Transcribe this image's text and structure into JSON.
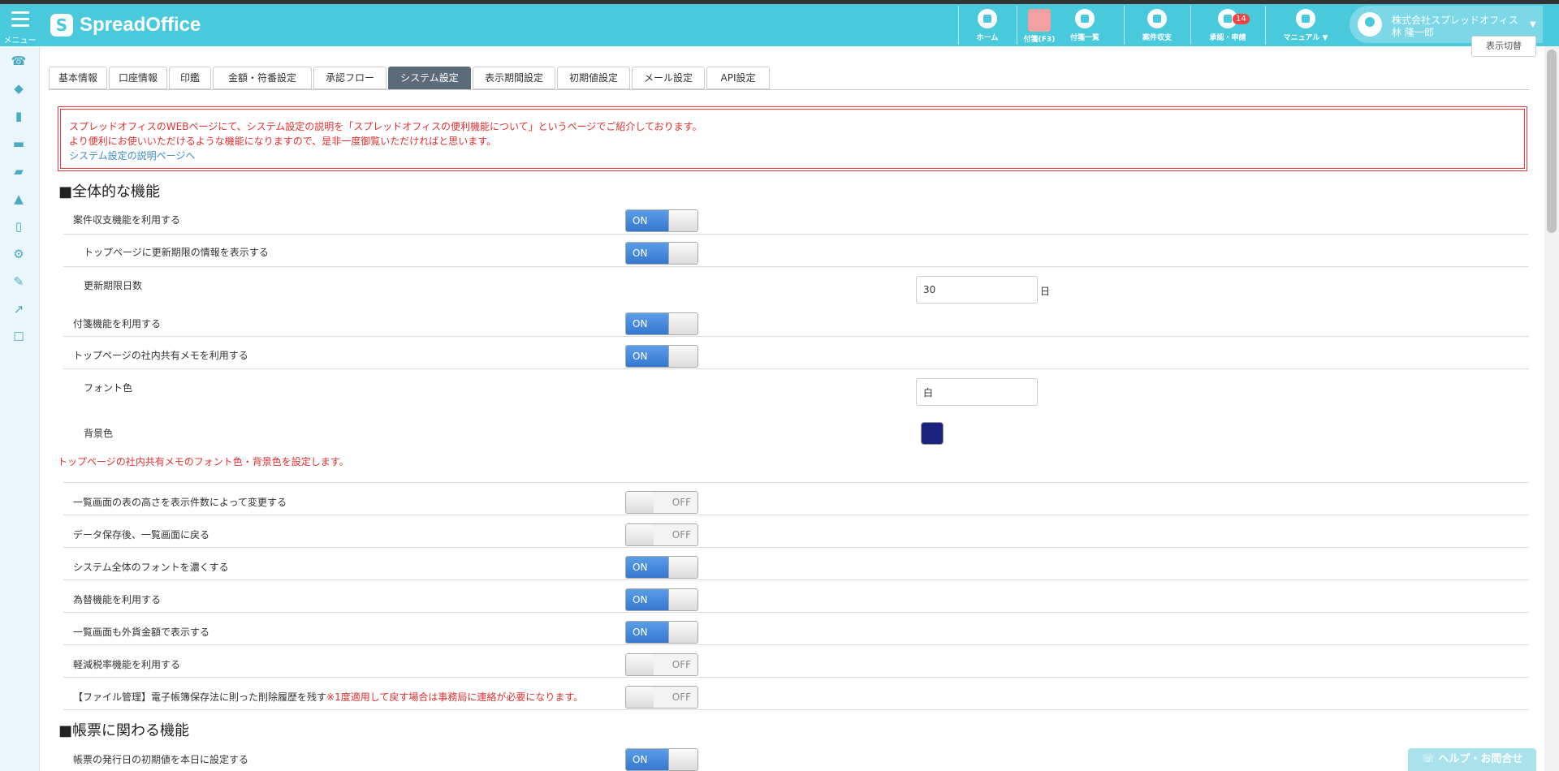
{
  "header": {
    "menu_label": "メニュー",
    "logo_text": "SpreadOffice",
    "nav": [
      {
        "label": "ホーム",
        "icon": "home-icon"
      },
      {
        "label": "付箋(F3)",
        "icon": "sticky-note-icon"
      },
      {
        "label": "付箋一覧",
        "icon": "pin-icon"
      },
      {
        "label": "案件収支",
        "icon": "chart-icon"
      },
      {
        "label": "承認・申請",
        "icon": "approval-icon",
        "badge": "14"
      },
      {
        "label": "マニュアル ▼",
        "icon": "manual-icon"
      }
    ],
    "user_company": "株式会社スプレッドオフィス",
    "user_name": "林 隆一郎",
    "user_caret": "▼"
  },
  "sidebar_icons": [
    "phone-icon",
    "tag-icon",
    "bar-chart-icon",
    "card-icon",
    "folder-icon",
    "signal-icon",
    "document-icon",
    "gear-icon",
    "wrench-icon",
    "external-link-icon",
    "checkbox-icon"
  ],
  "display_button": "表示切替",
  "tabs": [
    "基本情報",
    "口座情報",
    "印鑑",
    "金額・符番設定",
    "承認フロー",
    "システム設定",
    "表示期間設定",
    "初期値設定",
    "メール設定",
    "API設定"
  ],
  "active_tab": "システム設定",
  "notice": {
    "line1": "スプレッドオフィスのWEBページにて、システム設定の説明を「スプレッドオフィスの便利機能について」というページでご紹介しております。",
    "line2": "より便利にお使いいただけるような機能になりますので、是非一度御覧いただければと思います。",
    "link": "システム設定の説明ページへ"
  },
  "section1": {
    "title": "■全体的な機能",
    "rows": [
      {
        "label": "案件収支機能を利用する",
        "state": "ON"
      },
      {
        "label": "トップページに更新期限の情報を表示する",
        "state": "ON"
      },
      {
        "label": "付箋機能を利用する",
        "state": "ON"
      },
      {
        "label": "トップページの社内共有メモを利用する",
        "state": "ON"
      }
    ],
    "renewal_days_label": "更新期限日数",
    "renewal_days_value": "30",
    "renewal_days_unit": "日",
    "font_color_label": "フォント色",
    "font_color_value": "白",
    "bg_color_label": "背景色",
    "bg_color_value": "#1a237e",
    "memo_note": "トップページの社内共有メモのフォント色・背景色を設定します。",
    "rows2": [
      {
        "label": "一覧画面の表の高さを表示件数によって変更する",
        "state": "OFF"
      },
      {
        "label": "データ保存後、一覧画面に戻る",
        "state": "OFF"
      },
      {
        "label": "システム全体のフォントを濃くする",
        "state": "ON"
      },
      {
        "label": "為替機能を利用する",
        "state": "ON"
      },
      {
        "label": "一覧画面も外貨金額で表示する",
        "state": "ON"
      },
      {
        "label": "軽減税率機能を利用する",
        "state": "OFF"
      }
    ],
    "file_row_label": "【ファイル管理】電子帳簿保存法に則った削除履歴を残す",
    "file_row_note": "※1度適用して戻す場合は事務局に連絡が必要になります。",
    "file_row_state": "OFF"
  },
  "section2": {
    "title": "■帳票に関わる機能",
    "rows": [
      {
        "label": "帳票の発行日の初期値を本日に設定する",
        "state": "ON"
      }
    ]
  },
  "help_button": "ヘルプ・お問合せ"
}
